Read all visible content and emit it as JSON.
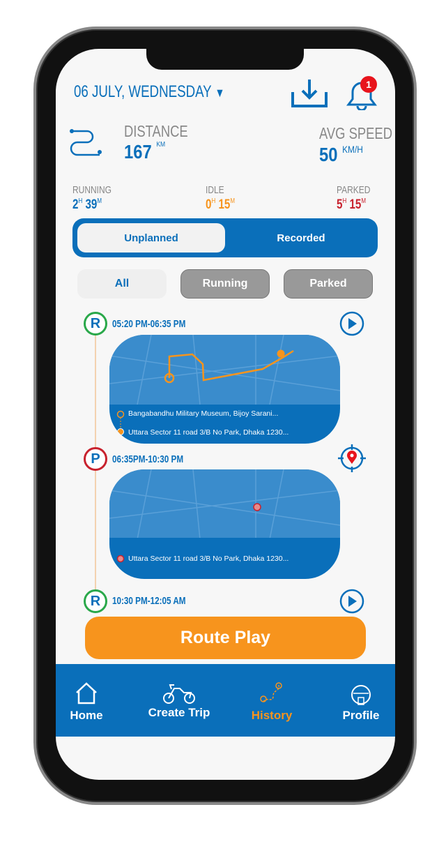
{
  "header": {
    "date": "06 JULY, WEDNESDAY",
    "notification_count": "1"
  },
  "stats": {
    "distance_label": "DISTANCE",
    "distance_value": "167",
    "distance_unit": "KM",
    "speed_label": "AVG SPEED",
    "speed_value": "50",
    "speed_unit": "KM/H",
    "running_label": "RUNNING",
    "running_h": "2",
    "running_m": "39",
    "idle_label": "IDLE",
    "idle_h": "0",
    "idle_m": "15",
    "parked_label": "PARKED",
    "parked_h": "5",
    "parked_m": "15",
    "h": "H",
    "m": "M"
  },
  "colors": {
    "primary": "#0a6fba",
    "accent": "#f7941d",
    "running": "#2aa84a",
    "parked": "#c8222e"
  },
  "segment": {
    "tabs": [
      "Unplanned",
      "Recorded"
    ],
    "selected": "Unplanned"
  },
  "filters": {
    "items": [
      "All",
      "Running",
      "Parked"
    ],
    "selected": "All"
  },
  "timeline": [
    {
      "badge": "R",
      "type": "running",
      "time": "05:20 PM-06:35 PM",
      "action_icon": "play-icon",
      "from": "Bangabandhu Military Museum, Bijoy Sarani...",
      "to": "Uttara Sector 11 road 3/B No Park, Dhaka 1230..."
    },
    {
      "badge": "P",
      "type": "parked",
      "time": "06:35PM-10:30 PM",
      "action_icon": "location-target-icon",
      "location": "Uttara Sector 11 road 3/B No Park, Dhaka 1230..."
    },
    {
      "badge": "R",
      "type": "running",
      "time": "10:30 PM-12:05 AM",
      "action_icon": "play-icon"
    }
  ],
  "route_play_label": "Route Play",
  "nav": {
    "items": [
      "Home",
      "Create Trip",
      "History",
      "Profile"
    ],
    "active": "History"
  }
}
